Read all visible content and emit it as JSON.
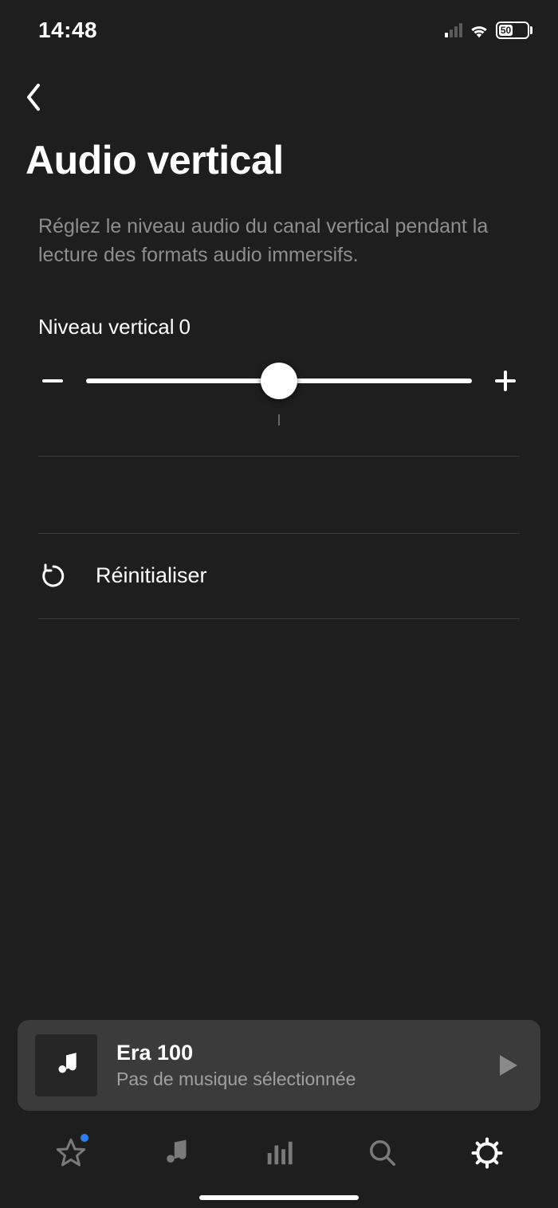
{
  "status": {
    "time": "14:48",
    "battery_percent": "50"
  },
  "page": {
    "title": "Audio vertical",
    "description": "Réglez le niveau audio du canal vertical pendant la lecture des formats audio immersifs."
  },
  "slider": {
    "label": "Niveau vertical",
    "value": "0"
  },
  "actions": {
    "reset_label": "Réinitialiser"
  },
  "now_playing": {
    "device": "Era 100",
    "status": "Pas de musique sélectionnée"
  }
}
